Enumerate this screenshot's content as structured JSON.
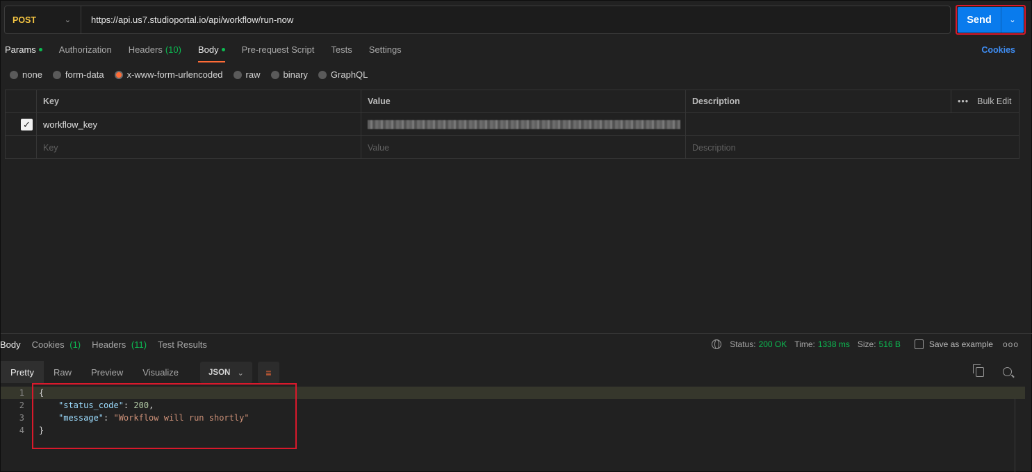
{
  "request": {
    "method": "POST",
    "url": "https://api.us7.studioportal.io/api/workflow/run-now",
    "send_label": "Send"
  },
  "request_tabs": [
    {
      "label": "Params",
      "active": false,
      "dot": true
    },
    {
      "label": "Authorization"
    },
    {
      "label": "Headers",
      "count": "(10)"
    },
    {
      "label": "Body",
      "active": true,
      "dot": true
    },
    {
      "label": "Pre-request Script"
    },
    {
      "label": "Tests"
    },
    {
      "label": "Settings"
    }
  ],
  "cookies_label": "Cookies",
  "body_types": [
    {
      "label": "none",
      "selected": false
    },
    {
      "label": "form-data",
      "selected": false
    },
    {
      "label": "x-www-form-urlencoded",
      "selected": true
    },
    {
      "label": "raw",
      "selected": false
    },
    {
      "label": "binary",
      "selected": false
    },
    {
      "label": "GraphQL",
      "selected": false
    }
  ],
  "params_table": {
    "headers": {
      "key": "Key",
      "value": "Value",
      "description": "Description",
      "bulk_edit": "Bulk Edit"
    },
    "rows": [
      {
        "checked": true,
        "key": "workflow_key",
        "value": "",
        "value_redacted": true,
        "description": ""
      }
    ],
    "placeholders": {
      "key": "Key",
      "value": "Value",
      "description": "Description"
    }
  },
  "response": {
    "tabs": [
      {
        "label": "Body",
        "active": true
      },
      {
        "label": "Cookies",
        "count": "(1)"
      },
      {
        "label": "Headers",
        "count": "(11)"
      },
      {
        "label": "Test Results"
      }
    ],
    "status_label": "Status:",
    "status_value": "200 OK",
    "time_label": "Time:",
    "time_value": "1338 ms",
    "size_label": "Size:",
    "size_value": "516 B",
    "save_example": "Save as example",
    "more": "ooo",
    "view_tabs": [
      "Pretty",
      "Raw",
      "Preview",
      "Visualize"
    ],
    "format": "JSON",
    "code": {
      "l1": "{",
      "l2_key": "\"status_code\"",
      "l2_colon": ": ",
      "l2_val": "200",
      "l2_end": ",",
      "l3_key": "\"message\"",
      "l3_colon": ": ",
      "l3_val": "\"Workflow will run shortly\"",
      "l4": "}"
    },
    "line_numbers": [
      "1",
      "2",
      "3",
      "4"
    ]
  },
  "colors": {
    "accent": "#ff6c37",
    "send": "#097bed",
    "highlight_border": "#d9192b",
    "success": "#0cbb52"
  }
}
